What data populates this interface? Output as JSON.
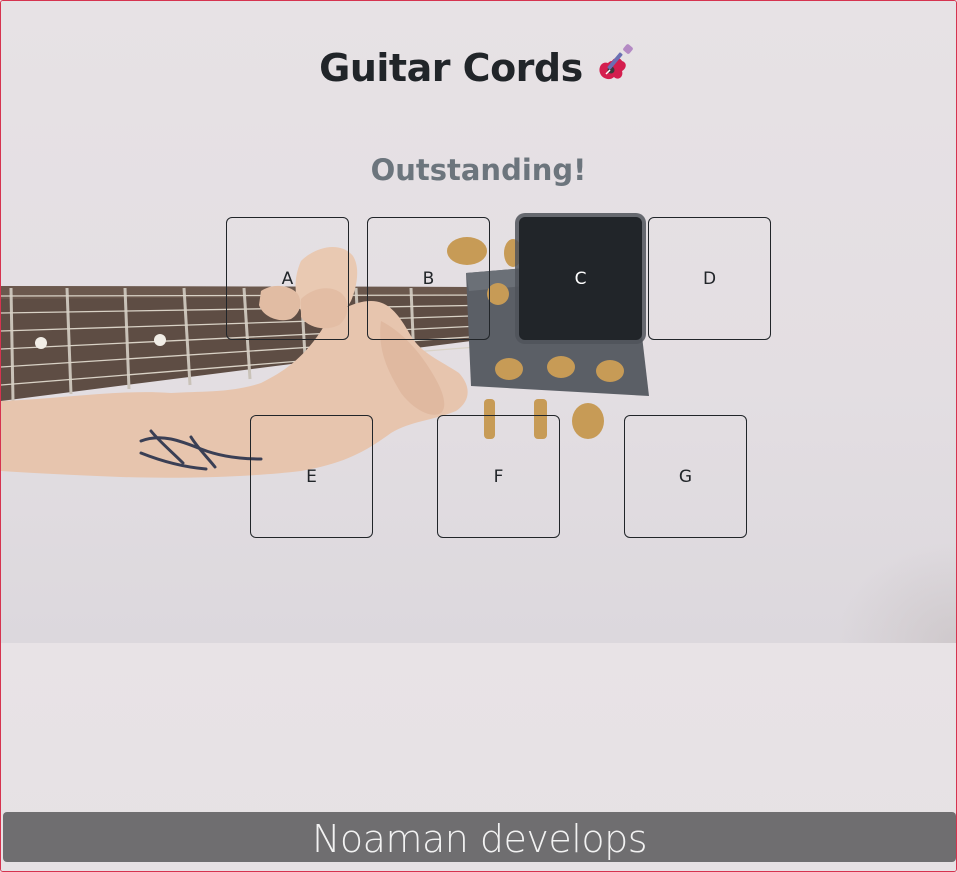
{
  "header": {
    "title": "Guitar Cords",
    "title_icon": "guitar-icon"
  },
  "status": {
    "message": "Outstanding!"
  },
  "chords": [
    {
      "label": "A",
      "selected": false
    },
    {
      "label": "B",
      "selected": false
    },
    {
      "label": "C",
      "selected": true
    },
    {
      "label": "D",
      "selected": false
    },
    {
      "label": "E",
      "selected": false
    },
    {
      "label": "F",
      "selected": false
    },
    {
      "label": "G",
      "selected": false
    }
  ],
  "footer": {
    "text": "Noaman develops"
  },
  "colors": {
    "frame_border": "#d6334f",
    "text_dark": "#212529",
    "text_muted": "#6c757d",
    "footer_bg": "#6f6e70",
    "selected_bg": "#212529"
  }
}
